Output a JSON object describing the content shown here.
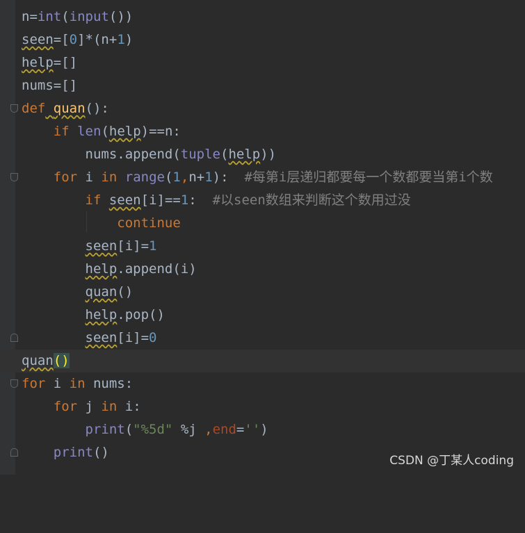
{
  "editor": {
    "language": "python",
    "lines": [
      "n=int(input())",
      "seen=[0]*(n+1)",
      "help=[]",
      "nums=[]",
      "def quan():",
      "    if len(help)==n:",
      "        nums.append(tuple(help))",
      "    for i in range(1,n+1):  #每第i层递归都要每一个数都要当第i个数",
      "        if seen[i]==1:  #以seen数组来判断这个数用过没",
      "            continue",
      "        seen[i]=1",
      "        help.append(i)",
      "        quan()",
      "        help.pop()",
      "        seen[i]=0",
      "quan()",
      "for i in nums:",
      "    for j in i:",
      "        print(\"%5d\" %j ,end='')",
      "    print()"
    ],
    "current_line": 16
  },
  "watermark": "CSDN @丁某人coding",
  "colors": {
    "background": "#2b2b2b",
    "gutter": "#313335",
    "keyword": "#cc7832",
    "builtin": "#8888c6",
    "number": "#6897bb",
    "function_name": "#ffc66d",
    "string": "#6a8759",
    "comment": "#808080",
    "text": "#a9b7c6"
  }
}
